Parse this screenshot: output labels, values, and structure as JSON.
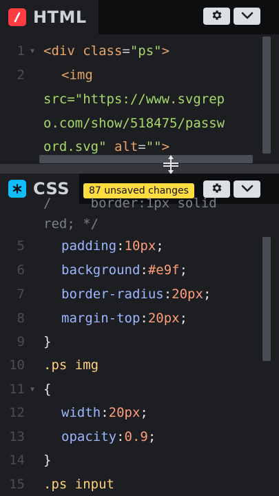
{
  "html_panel": {
    "title": "HTML",
    "lines": {
      "n1": "1",
      "n2": "2",
      "l1_open": "<div",
      "l1_attr": " class",
      "l1_eq": "=",
      "l1_val": "\"ps\"",
      "l1_close": ">",
      "l2_open": "<img",
      "l3": "src=\"https://www.svgrep",
      "l4": "o.com/show/518475/passw",
      "l5_str": "ord.svg\"",
      "l5_attr": " alt",
      "l5_eq": "=",
      "l5_val": "\"\"",
      "l5_close": ">"
    }
  },
  "css_panel": {
    "title": "CSS",
    "unsaved": "87 unsaved changes",
    "partial_top": "/     border:1px solid",
    "partial_red": "red; */",
    "rows": [
      {
        "n": "5",
        "prop": "padding",
        "colon": ":",
        "val": "10px",
        "semi": ";"
      },
      {
        "n": "6",
        "prop": "background",
        "colon": ":",
        "val": "#e9f",
        "semi": ";"
      },
      {
        "n": "7",
        "prop": "border-radius",
        "colon": ":",
        "val": "20px",
        "semi": ";"
      },
      {
        "n": "8",
        "prop": "margin-top",
        "colon": ":",
        "val": "20px",
        "semi": ";"
      }
    ],
    "n9": "9",
    "brace_close": "}",
    "n10": "10",
    "sel_ps_img": ".ps img",
    "n11": "11",
    "brace_open": "{",
    "row12": {
      "n": "12",
      "prop": "width",
      "colon": ":",
      "val": "20px",
      "semi": ";"
    },
    "row13": {
      "n": "13",
      "prop": "opacity",
      "colon": ":",
      "val": "0.9",
      "semi": ";"
    },
    "n14": "14",
    "n15": "15",
    "sel_ps_input": ".ps input"
  },
  "icons": {
    "html_badge": "slash-icon",
    "css_badge": "asterisk-icon",
    "settings": "gear-icon",
    "collapse": "chevron-down-icon"
  },
  "colors": {
    "html_badge": "#ff3c41",
    "css_badge": "#0ebeff",
    "unsaved_badge": "#ffdd40"
  }
}
